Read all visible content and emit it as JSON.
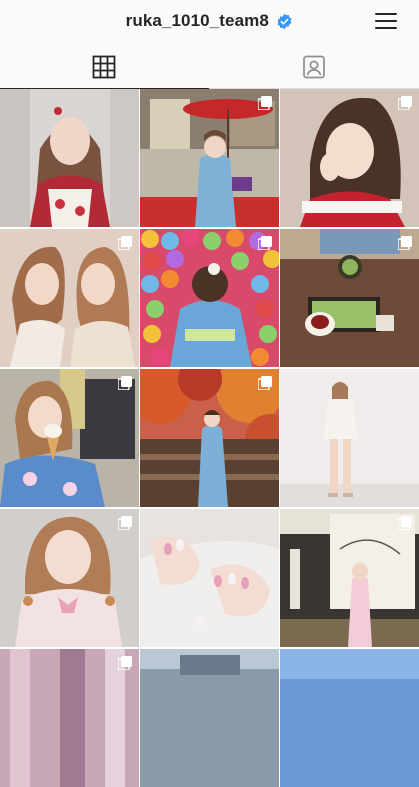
{
  "profile": {
    "username": "ruka_1010_team8",
    "verified_icon": "verified-badge-icon"
  },
  "header": {
    "menu_icon": "hamburger-menu-icon"
  },
  "tabs": [
    {
      "name": "grid",
      "icon": "grid-icon",
      "active": true
    },
    {
      "name": "tagged",
      "icon": "tagged-person-icon",
      "active": false
    }
  ],
  "posts": [
    {
      "description": "idol in floral dress",
      "multi": false
    },
    {
      "description": "kimono with red umbrella",
      "multi": true
    },
    {
      "description": "santa outfit",
      "multi": true
    },
    {
      "description": "two girls selfie",
      "multi": true
    },
    {
      "description": "kimono in front of colorful balls",
      "multi": true
    },
    {
      "description": "matcha tea set",
      "multi": true
    },
    {
      "description": "kimono with ice cream",
      "multi": true
    },
    {
      "description": "autumn leaves kimono",
      "multi": true
    },
    {
      "description": "white outfit full body",
      "multi": false
    },
    {
      "description": "pink blouse pigtails",
      "multi": true
    },
    {
      "description": "manicure nails",
      "multi": false
    },
    {
      "description": "shop curtain kimono",
      "multi": true
    }
  ],
  "colors": {
    "verified": "#3897f0",
    "text": "#262626",
    "divider": "#dbdbdb"
  }
}
